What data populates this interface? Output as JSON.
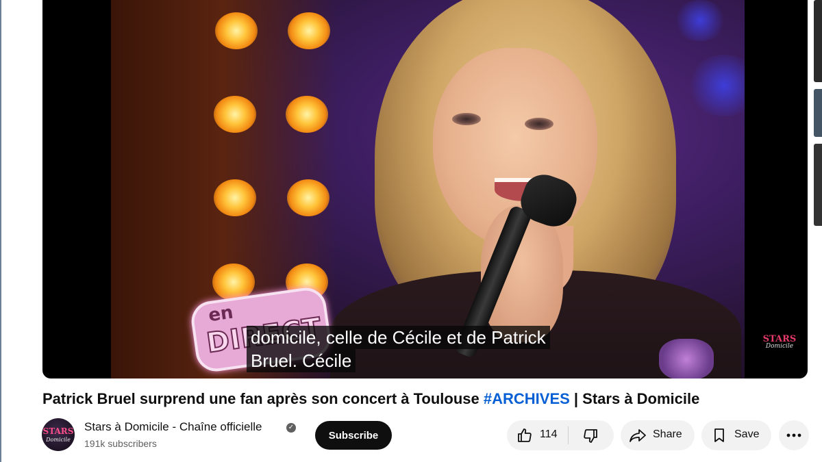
{
  "video": {
    "captions": [
      "domicile, celle de Cécile et de Patrick",
      "Bruel. Cécile"
    ],
    "overlay_logo": {
      "line1": "en",
      "line2": "DIRECT"
    },
    "watermark": {
      "line1": "STARS",
      "line2": "Domicile"
    }
  },
  "title": {
    "main": "Patrick Bruel surprend une fan après son concert à Toulouse ",
    "hashtag": "#ARCHIVES",
    "suffix": " | Stars à Domicile"
  },
  "channel": {
    "avatar": {
      "line1": "STARS",
      "line2": "Domicile"
    },
    "name": "Stars à Domicile - Chaîne officielle",
    "subscribers": "191k subscribers",
    "verified_icon": "check-circle-icon"
  },
  "actions": {
    "subscribe_label": "Subscribe",
    "like_count": "114",
    "share_label": "Share",
    "save_label": "Save"
  },
  "colors": {
    "hashtag": "#065fd4",
    "subscribe_bg": "#0f0f0f",
    "pill_bg": "#f2f2f2"
  }
}
